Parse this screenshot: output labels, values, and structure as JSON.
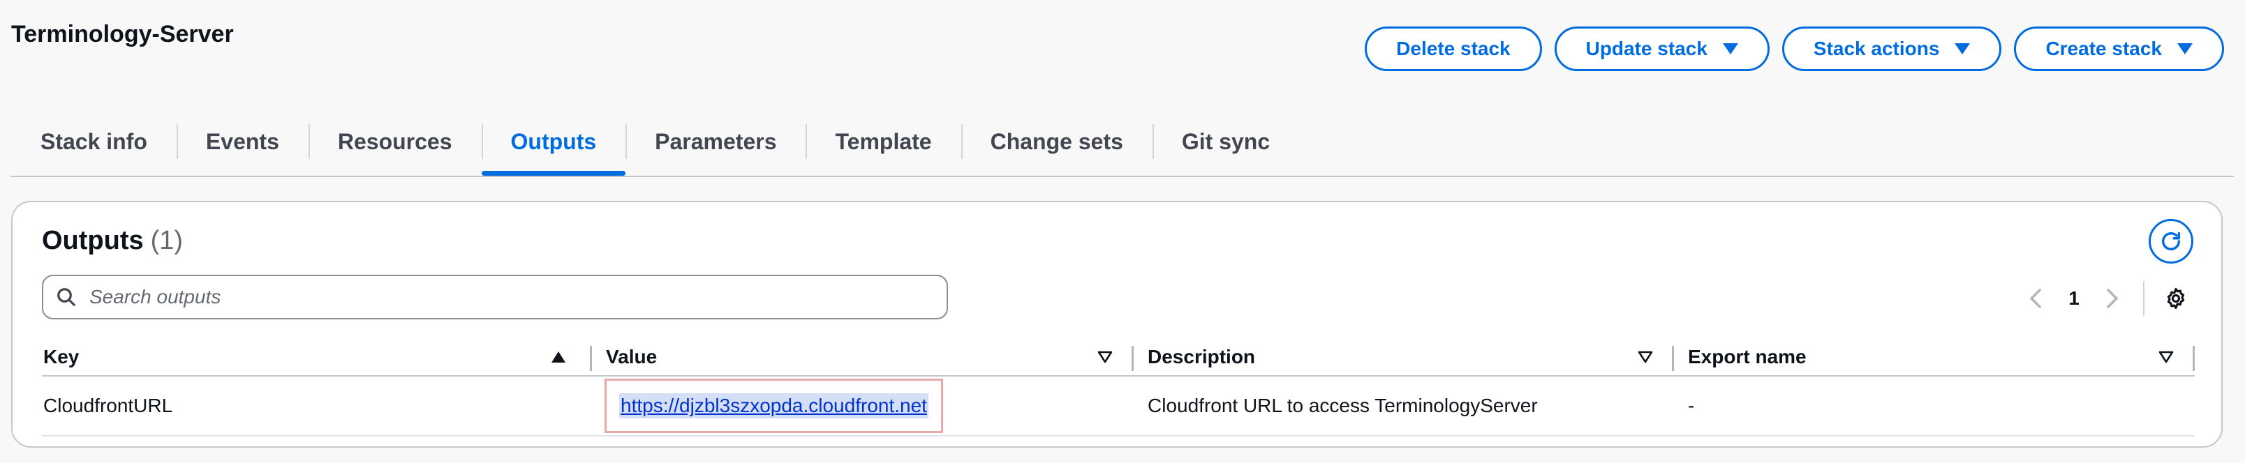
{
  "header": {
    "title": "Terminology-Server",
    "actions": {
      "delete": "Delete stack",
      "update": "Update stack",
      "stack_actions": "Stack actions",
      "create": "Create stack"
    }
  },
  "tabs": [
    {
      "label": "Stack info",
      "active": false
    },
    {
      "label": "Events",
      "active": false
    },
    {
      "label": "Resources",
      "active": false
    },
    {
      "label": "Outputs",
      "active": true
    },
    {
      "label": "Parameters",
      "active": false
    },
    {
      "label": "Template",
      "active": false
    },
    {
      "label": "Change sets",
      "active": false
    },
    {
      "label": "Git sync",
      "active": false
    }
  ],
  "outputs": {
    "title": "Outputs",
    "count": "(1)",
    "search_placeholder": "Search outputs",
    "page": "1",
    "columns": {
      "key": "Key",
      "value": "Value",
      "description": "Description",
      "export_name": "Export name"
    },
    "rows": [
      {
        "key": "CloudfrontURL",
        "value": "https://djzbl3szxopda.cloudfront.net",
        "description": "Cloudfront URL to access TerminologyServer",
        "export_name": "-"
      }
    ]
  },
  "colors": {
    "accent": "#006ce0",
    "link": "#0033cc",
    "highlight_border": "#e8a9a9"
  }
}
